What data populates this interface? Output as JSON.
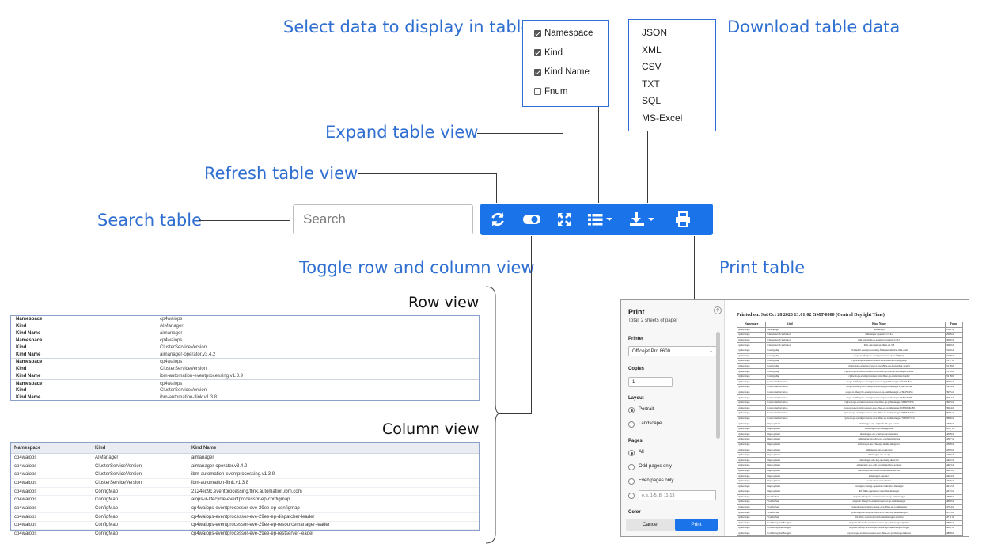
{
  "callouts": {
    "select": "Select data to display in table",
    "download": "Download table data",
    "expand": "Expand table view",
    "refresh": "Refresh table view",
    "search": "Search table",
    "toggle": "Toggle row and column view",
    "print": "Print table"
  },
  "search": {
    "placeholder": "Search"
  },
  "toolbar": {
    "color": "#1a73e8",
    "icons": [
      "refresh-icon",
      "toggle-icon",
      "expand-icon",
      "columns-icon",
      "download-icon",
      "print-icon"
    ]
  },
  "columns_menu": {
    "items": [
      {
        "label": "Namespace",
        "checked": true
      },
      {
        "label": "Kind",
        "checked": true
      },
      {
        "label": "Kind Name",
        "checked": true
      },
      {
        "label": "Fnum",
        "checked": false
      }
    ]
  },
  "download_menu": {
    "items": [
      "JSON",
      "XML",
      "CSV",
      "TXT",
      "SQL",
      "MS-Excel"
    ]
  },
  "row_view": {
    "title": "Row view",
    "records": [
      {
        "Namespace": "cp4waiops",
        "Kind": "AIManager",
        "Kind Name": "aimanager"
      },
      {
        "Namespace": "cp4waiops",
        "Kind": "ClusterServiceVersion",
        "Kind Name": "aimanager-operator.v3.4.2"
      },
      {
        "Namespace": "cp4waiops",
        "Kind": "ClusterServiceVersion",
        "Kind Name": "ibm-automation-eventprocessing.v1.3.9"
      },
      {
        "Namespace": "cp4waiops",
        "Kind": "ClusterServiceVersion",
        "Kind Name": "ibm-automation-flink.v1.3.8"
      }
    ],
    "labels": {
      "ns": "Namespace",
      "kind": "Kind",
      "name": "Kind Name"
    }
  },
  "column_view": {
    "title": "Column view",
    "headers": [
      "Namespace",
      "Kind",
      "Kind Name"
    ],
    "rows": [
      [
        "cp4waiops",
        "AIManager",
        "aimanager"
      ],
      [
        "cp4waiops",
        "ClusterServiceVersion",
        "aimanager-operator.v3.4.2"
      ],
      [
        "cp4waiops",
        "ClusterServiceVersion",
        "ibm-automation-eventprocessing.v1.3.9"
      ],
      [
        "cp4waiops",
        "ClusterServiceVersion",
        "ibm-automation-flink.v1.3.8"
      ],
      [
        "cp4waiops",
        "ConfigMap",
        "2124ed9c.eventprocessing.flink.automation.ibm.com"
      ],
      [
        "cp4waiops",
        "ConfigMap",
        "aiops-ir-lifecycle-eventprocessor-ep-configmap"
      ],
      [
        "cp4waiops",
        "ConfigMap",
        "cp4waiops-eventprocessor-eve-29ee-ep-configmap"
      ],
      [
        "cp4waiops",
        "ConfigMap",
        "cp4waiops-eventprocessor-eve-29ee-ep-dispatcher-leader"
      ],
      [
        "cp4waiops",
        "ConfigMap",
        "cp4waiops-eventprocessor-eve-29ee-ep-resourcemanager-leader"
      ],
      [
        "cp4waiops",
        "ConfigMap",
        "cp4waiops-eventprocessor-eve-29ee-ep-restserver-leader"
      ]
    ]
  },
  "print_dialog": {
    "title": "Print",
    "subtitle": "Total: 2 sheets of paper",
    "help": "?",
    "printer_label": "Printer",
    "printer_value": "Officejet Pro 8600",
    "copies_label": "Copies",
    "copies_value": "1",
    "layout_label": "Layout",
    "portrait": "Portrait",
    "landscape": "Landscape",
    "pages_label": "Pages",
    "pages_all": "All",
    "pages_odd": "Odd pages only",
    "pages_even": "Even pages only",
    "pages_custom_placeholder": "e.g. 1-5, 8, 11-13",
    "color_label": "Color",
    "cancel": "Cancel",
    "print": "Print",
    "preview_heading": "Printed on: Sat Oct 28 2023 13:01:02 GMT-0500 (Central Daylight Time)",
    "preview_headers": [
      "Namespace",
      "Kind",
      "Kind Name",
      "Fnum"
    ],
    "preview_rows": [
      [
        "cp4waiops",
        "AIManager",
        "aimanager",
        "1001.0"
      ],
      [
        "cp4waiops",
        "ClusterServiceVersion",
        "aimanager-operator.v3.4.2",
        "2006.0"
      ],
      [
        "cp4waiops",
        "ClusterServiceVersion",
        "ibm-automation-eventprocessing.v1.3.9",
        "3000.0"
      ],
      [
        "cp4waiops",
        "ClusterServiceVersion",
        "ibm-automation-flink.v1.3.8",
        "3009.0"
      ],
      [
        "cp4waiops",
        "ConfigMap",
        "2124ed9c.eventprocessing.flink.automation.ibm.com",
        "3109.0"
      ],
      [
        "cp4waiops",
        "ConfigMap",
        "aiops-ir-lifecycle-eventprocessor-ep-configmap",
        "3108.0"
      ],
      [
        "cp4waiops",
        "ConfigMap",
        "cp4waiops-eventprocessor-eve-29ee-ep-configmap",
        "3117.0"
      ],
      [
        "cp4waiops",
        "ConfigMap",
        "cp4waiops-eventprocessor-eve-29ee-ep-dispatcher-leader",
        "3118.0"
      ],
      [
        "cp4waiops",
        "ConfigMap",
        "cp4waiops-eventprocessor-eve-29ee-ep-resourcemanager-leader",
        "3119.0"
      ],
      [
        "cp4waiops",
        "ConfigMap",
        "cp4waiops-eventprocessor-eve-29ee-ep-restserver-leader",
        "3118.0"
      ],
      [
        "cp4waiops",
        "ControllerRevision",
        "aiops-ir-lifecycle-eventprocessor-ep-jobmanager-5f7c75c8cc",
        "3953.0"
      ],
      [
        "cp4waiops",
        "ControllerRevision",
        "aiops-ir-lifecycle-eventprocessor-ep-jobmanager-c56c78fcd9",
        "3954.0"
      ],
      [
        "cp4waiops",
        "ControllerRevision",
        "aiops-ir-lifecycle-eventprocessor-ep-taskmanager-5c8dd59458",
        "3955.0"
      ],
      [
        "cp4waiops",
        "ControllerRevision",
        "aiops-ir-lifecycle-eventprocessor-ep-taskmanager-5589c6b86",
        "3962.0"
      ],
      [
        "cp4waiops",
        "ControllerRevision",
        "cp4waiops-eventprocessor-eve-29ee-ep-jobmanager-566657d5b",
        "3963.0"
      ],
      [
        "cp4waiops",
        "ControllerRevision",
        "cp4waiops-eventprocessor-eve-29ee-ep-jobmanager-5b859bdbd85",
        "3964.0"
      ],
      [
        "cp4waiops",
        "ControllerRevision",
        "cp4waiops-eventprocessor-eve-29ee-ep-taskmanager-6668c74c7c",
        "3965.0"
      ],
      [
        "cp4waiops",
        "ControllerRevision",
        "cp4waiops-eventprocessor-eve-29ee-ep-taskmanager-7b656f7ccd",
        "3966.0"
      ],
      [
        "cp4waiops",
        "Deployment",
        "aimanager-aio-ai-platform-api-server",
        "4396.0"
      ],
      [
        "cp4waiops",
        "Deployment",
        "aimanager-aio-change-risk",
        "4397.0"
      ],
      [
        "cp4waiops",
        "Deployment",
        "aimanager-aio-chatops-orchestrator",
        "4398.0"
      ],
      [
        "cp4waiops",
        "Deployment",
        "aimanager-aio-chatops-slack-integrator",
        "4387.0"
      ],
      [
        "cp4waiops",
        "Deployment",
        "aimanager-aio-chatops-teams-integrator",
        "4388.0"
      ],
      [
        "cp4waiops",
        "Deployment",
        "aimanager-aio-controller",
        "4399.0"
      ],
      [
        "cp4waiops",
        "Deployment",
        "aimanager-aio-cr-api",
        "4400.0"
      ],
      [
        "cp4waiops",
        "Deployment",
        "aimanager-aio-log-anomaly-detector",
        "4402.0"
      ],
      [
        "cp4waiops",
        "Deployment",
        "aimanager-aio-oob-recommended-actions",
        "4403.0"
      ],
      [
        "cp4waiops",
        "Deployment",
        "aimanager-aio-similar-incidents-service",
        "4405.0"
      ],
      [
        "cp4waiops",
        "Deployment",
        "aimanager-operator",
        "4404.0"
      ],
      [
        "cp4waiops",
        "Deployment",
        "connector-orchestrator",
        "4406.0"
      ],
      [
        "cp4waiops",
        "Deployment",
        "eventprocessing-operator-controller-manager",
        "4472.0"
      ],
      [
        "cp4waiops",
        "Deployment",
        "ibf-flink-operator-controller-manager",
        "4473.0"
      ],
      [
        "cp4waiops",
        "StatefulSet",
        "aiops-ir-lifecycle-eventprocessor-ep-jobmanager",
        "4698.0"
      ],
      [
        "cp4waiops",
        "StatefulSet",
        "aiops-ir-lifecycle-eventprocessor-ep-taskmanager",
        "4699.0"
      ],
      [
        "cp4waiops",
        "StatefulSet",
        "cp4waiops-eventprocessor-eve-29ee-ep-jobmanager",
        "4704.0"
      ],
      [
        "cp4waiops",
        "StatefulSet",
        "cp4waiops-eventprocessor-eve-29ee-ep-taskmanager",
        "4705.0"
      ],
      [
        "cp4waiops",
        "StatefulSet",
        "ibf-flink-operator-controller-manager-service",
        "4711.0"
      ],
      [
        "cp4waiops",
        "PodDisruptionBudget",
        "aiops-ir-lifecycle-eventprocessor-ep-jobmanager-hprmw",
        "4890.0"
      ],
      [
        "cp4waiops",
        "PodDisruptionBudget",
        "aiops-ir-lifecycle-eventprocessor-ep-taskmanager-f2qgs",
        "4891.0"
      ],
      [
        "cp4waiops",
        "PodDisruptionBudget",
        "cp4waiops-eventprocessor-eve-29ee-ep-jobmanager-aksyn",
        "4898.0"
      ],
      [
        "cp4waiops",
        "PodDisruptionBudget",
        "cp4waiops-eventprocessor-eve-29ee-ep-taskmanager-plk7f",
        "4897.0"
      ]
    ]
  }
}
